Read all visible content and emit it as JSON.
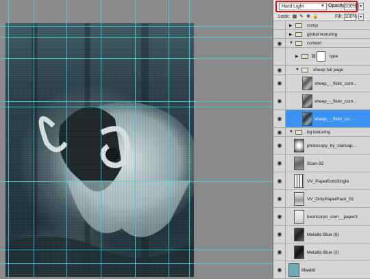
{
  "blend": {
    "mode": "Hard Light",
    "opacity_label": "Opacity:",
    "opacity_value": "100%"
  },
  "lock": {
    "label": "Lock:",
    "fill_label": "Fill:",
    "fill_value": "100%"
  },
  "layers": [
    {
      "name": "comp",
      "kind": "group",
      "visible": false,
      "expanded": false
    },
    {
      "name": "global texturing",
      "kind": "group",
      "visible": false,
      "expanded": false
    },
    {
      "name": "content",
      "kind": "group",
      "visible": true,
      "expanded": true
    },
    {
      "name": "type",
      "kind": "group",
      "visible": false,
      "expanded": false
    },
    {
      "name": "sheep full page",
      "kind": "group",
      "visible": true,
      "expanded": true
    },
    {
      "name": "sheep_-_flickr_com...",
      "kind": "image",
      "visible": true
    },
    {
      "name": "sheep_-_flickr_com...",
      "kind": "image",
      "visible": true
    },
    {
      "name": "sheep_-_flickr_co...",
      "kind": "image",
      "visible": true,
      "selected": true
    },
    {
      "name": "bg texturing",
      "kind": "group",
      "visible": true,
      "expanded": true
    },
    {
      "name": "photocopy_by_clarisap...",
      "kind": "image",
      "visible": true
    },
    {
      "name": "Scan-32",
      "kind": "image",
      "visible": true
    },
    {
      "name": "VV_PaperDotsSingle",
      "kind": "image",
      "visible": true
    },
    {
      "name": "VV_DirtyPaperPack_02",
      "kind": "image",
      "visible": true
    },
    {
      "name": "beshcorpo_com__paper3",
      "kind": "image",
      "visible": true
    },
    {
      "name": "Metallic Blue (6)",
      "kind": "image",
      "visible": true
    },
    {
      "name": "Metallic Blue (2)",
      "kind": "image",
      "visible": true
    },
    {
      "name": "6faab8",
      "kind": "fill",
      "visible": true
    }
  ],
  "colors": {
    "guides": "#38d6e6",
    "selection": "#3d93f2",
    "highlight_border": "#c01818",
    "fill_swatch": "#6faab8"
  }
}
